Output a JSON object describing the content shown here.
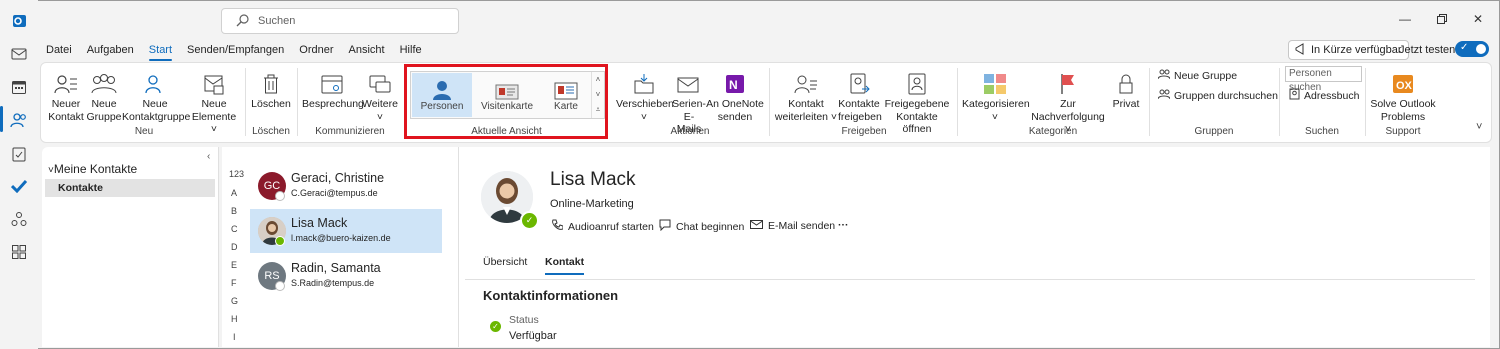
{
  "titlebar": {
    "search_placeholder": "Suchen"
  },
  "menu": {
    "tabs": [
      "Datei",
      "Aufgaben",
      "Start",
      "Senden/Empfangen",
      "Ordner",
      "Ansicht",
      "Hilfe"
    ],
    "active": "Start"
  },
  "header_right": {
    "coming_soon": "In Kürze verfügbar",
    "try_now": "Jetzt testen"
  },
  "ribbon": {
    "new": {
      "contact": [
        "Neuer",
        "Kontakt"
      ],
      "group": [
        "Neue",
        "Gruppe"
      ],
      "contact_group": [
        "Neue",
        "Kontaktgruppe"
      ],
      "items": [
        "Neue",
        "Elemente ˅"
      ],
      "label": "Neu"
    },
    "delete": {
      "btn": "Löschen",
      "label": "Löschen"
    },
    "communicate": {
      "meeting": "Besprechung",
      "more": "Weitere",
      "label": "Kommunizieren"
    },
    "view": {
      "people": "Personen",
      "card": "Visitenkarte",
      "map": "Karte",
      "label": "Aktuelle Ansicht"
    },
    "actions": {
      "move": "Verschieben",
      "mail": [
        "Serien-",
        "E-Mails"
      ],
      "onenote": [
        "An OneNote",
        "senden"
      ],
      "label": "Aktionen"
    },
    "share": {
      "forward": [
        "Kontakt",
        "weiterleiten ˅"
      ],
      "share_contacts": [
        "Kontakte",
        "freigeben"
      ],
      "open_shared": [
        "Freigegebene",
        "Kontakte öffnen"
      ],
      "label": "Freigeben"
    },
    "tags": {
      "categorize": "Kategorisieren",
      "followup": [
        "Zur",
        "Nachverfolgung ˅"
      ],
      "private": "Privat",
      "label": "Kategorien"
    },
    "groups": {
      "new_group": "Neue Gruppe",
      "browse": "Gruppen durchsuchen",
      "label": "Gruppen"
    },
    "find": {
      "search_people": "Personen suchen",
      "address_book": "Adressbuch",
      "label": "Suchen"
    },
    "support": {
      "solve": [
        "Solve Outlook",
        "Problems"
      ],
      "label": "Support"
    }
  },
  "folders": {
    "header": "Meine Kontakte",
    "item": "Kontakte"
  },
  "alphabet": [
    "123",
    "A",
    "B",
    "C",
    "D",
    "E",
    "F",
    "G",
    "H",
    "I"
  ],
  "contacts": [
    {
      "initials": "GC",
      "name": "Geraci, Christine",
      "email": "C.Geraci@tempus.de",
      "color": "#8b1a2b"
    },
    {
      "initials": "",
      "name": "Lisa Mack",
      "email": "l.mack@buero-kaizen.de",
      "color": "#c9b9a8"
    },
    {
      "initials": "RS",
      "name": "Radin, Samanta",
      "email": "S.Radin@tempus.de",
      "color": "#6e7880"
    }
  ],
  "detail": {
    "name": "Lisa Mack",
    "role": "Online-Marketing",
    "actions": [
      "Audioanruf starten",
      "Chat beginnen",
      "E-Mail senden",
      "···"
    ],
    "tabs": [
      "Übersicht",
      "Kontakt"
    ],
    "section": "Kontaktinformationen",
    "status_label": "Status",
    "status_value": "Verfügbar"
  },
  "colors": {
    "accent": "#0f6cbd",
    "highlight": "#e0141e",
    "presence": "#6bb700"
  }
}
